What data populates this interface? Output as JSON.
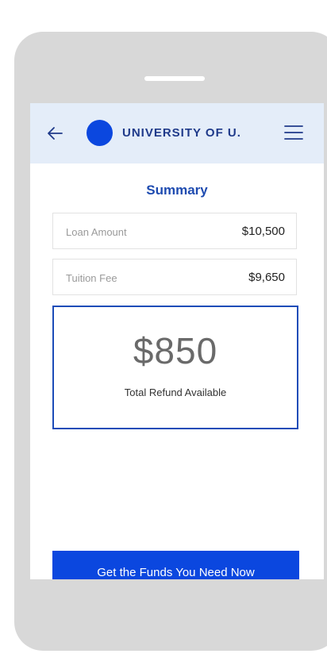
{
  "header": {
    "brand_name": "UNIVERSITY OF U.",
    "back_icon": "arrow-left-icon",
    "menu_icon": "hamburger-menu-icon",
    "logo_color": "#0b47df"
  },
  "summary": {
    "title": "Summary",
    "rows": [
      {
        "label": "Loan Amount",
        "value": "$10,500"
      },
      {
        "label": "Tuition Fee",
        "value": "$9,650"
      }
    ],
    "refund": {
      "amount": "$850",
      "label": "Total Refund Available"
    }
  },
  "cta": {
    "label": "Get the Funds You Need Now",
    "color": "#0b47df"
  }
}
